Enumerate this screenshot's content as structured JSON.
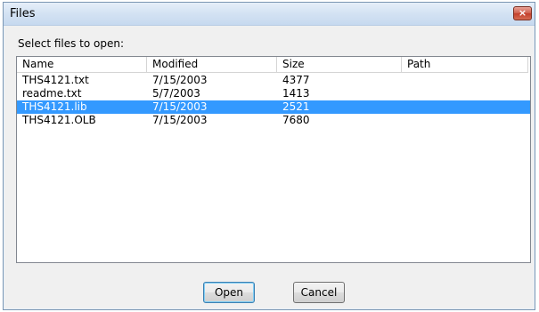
{
  "window": {
    "title": "Files",
    "close_glyph": "×"
  },
  "prompt": "Select files to open:",
  "list": {
    "columns": [
      "Name",
      "Modified",
      "Size",
      "Path"
    ],
    "rows": [
      {
        "name": "THS4121.txt",
        "modified": "7/15/2003",
        "size": "4377",
        "path": "",
        "selected": false
      },
      {
        "name": "readme.txt",
        "modified": "5/7/2003",
        "size": "1413",
        "path": "",
        "selected": false
      },
      {
        "name": "THS4121.lib",
        "modified": "7/15/2003",
        "size": "2521",
        "path": "",
        "selected": true
      },
      {
        "name": "THS4121.OLB",
        "modified": "7/15/2003",
        "size": "7680",
        "path": "",
        "selected": false
      }
    ]
  },
  "buttons": {
    "open_label": "Open",
    "cancel_label": "Cancel"
  },
  "colors": {
    "selection": "#3399ff",
    "titlebar": "#d3e2f3",
    "close": "#c3402b"
  }
}
